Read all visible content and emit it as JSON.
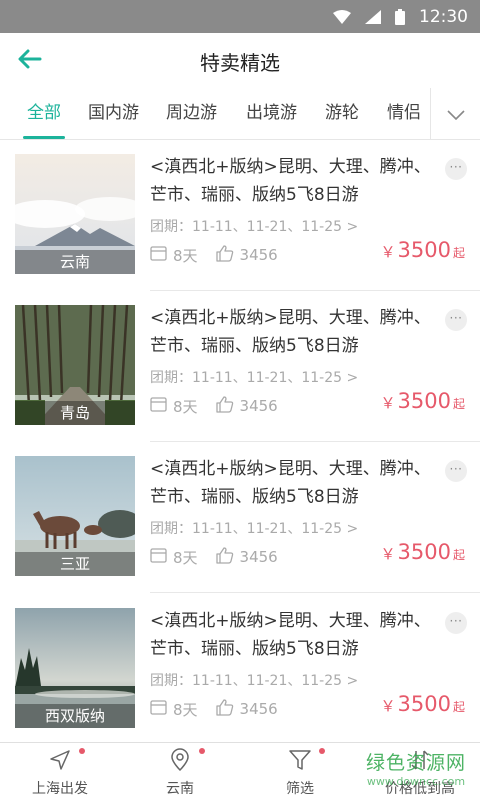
{
  "status_bar": {
    "time": "12:30",
    "icons": [
      "wifi-icon",
      "signal-icon",
      "battery-icon"
    ]
  },
  "header": {
    "title": "特卖精选",
    "back_icon": "arrow-left-icon"
  },
  "tabs": {
    "items": [
      {
        "label": "全部",
        "active": true
      },
      {
        "label": "国内游",
        "active": false
      },
      {
        "label": "周边游",
        "active": false
      },
      {
        "label": "出境游",
        "active": false
      },
      {
        "label": "游轮",
        "active": false
      },
      {
        "label": "情侣",
        "active": false
      }
    ],
    "more_icon": "chevron-down-icon"
  },
  "products": [
    {
      "city": "云南",
      "title": "<滇西北+版纳>昆明、大理、腾冲、芒市、瑞丽、版纳5飞8日游",
      "dates": "团期：11-11、11-21、11-25 >",
      "days": "8天",
      "likes": "3456",
      "currency": "￥",
      "price": "3500",
      "price_suffix": "起",
      "more": "···"
    },
    {
      "city": "青岛",
      "title": "<滇西北+版纳>昆明、大理、腾冲、芒市、瑞丽、版纳5飞8日游",
      "dates": "团期：11-11、11-21、11-25 >",
      "days": "8天",
      "likes": "3456",
      "currency": "￥",
      "price": "3500",
      "price_suffix": "起",
      "more": "···"
    },
    {
      "city": "三亚",
      "title": "<滇西北+版纳>昆明、大理、腾冲、芒市、瑞丽、版纳5飞8日游",
      "dates": "团期：11-11、11-21、11-25 >",
      "days": "8天",
      "likes": "3456",
      "currency": "￥",
      "price": "3500",
      "price_suffix": "起",
      "more": "···"
    },
    {
      "city": "西双版纳",
      "title": "<滇西北+版纳>昆明、大理、腾冲、芒市、瑞丽、版纳5飞8日游",
      "dates": "团期：11-11、11-21、11-25 >",
      "days": "8天",
      "likes": "3456",
      "currency": "￥",
      "price": "3500",
      "price_suffix": "起",
      "more": "···"
    }
  ],
  "bottom_bar": {
    "items": [
      {
        "label": "上海出发",
        "icon": "location-arrow-icon",
        "badge": true
      },
      {
        "label": "云南",
        "icon": "map-pin-icon",
        "badge": true
      },
      {
        "label": "筛选",
        "icon": "filter-icon",
        "badge": true
      },
      {
        "label": "价格低到高",
        "icon": "sort-icon",
        "badge": false
      }
    ]
  },
  "watermark": {
    "main": "绿色资源网",
    "sub": "www.downcc.com"
  },
  "colors": {
    "accent": "#1cb39b",
    "price": "#e6596a",
    "status_bar": "#8a8a8a"
  }
}
